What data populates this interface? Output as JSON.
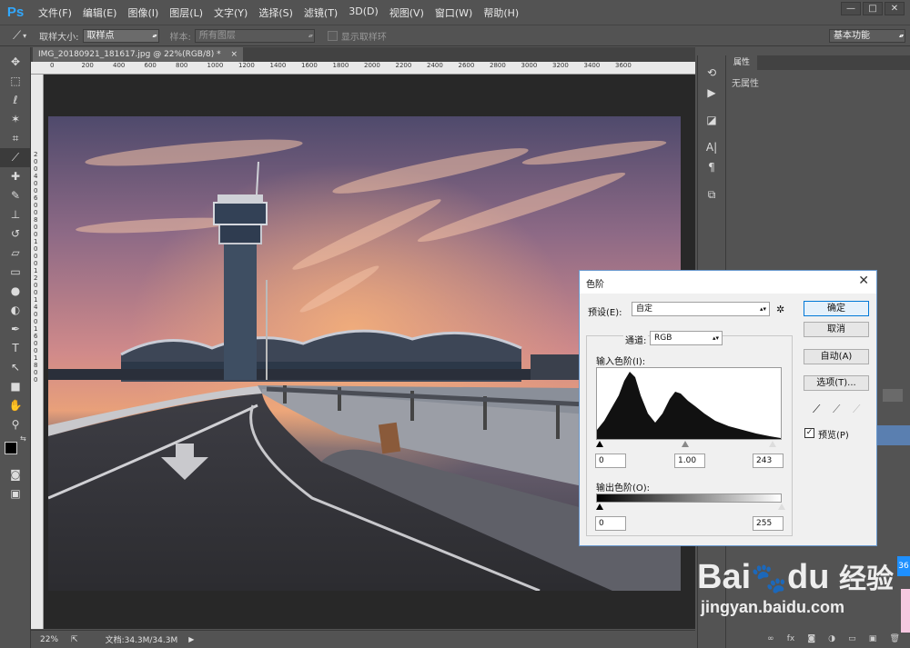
{
  "app": {
    "logo": "Ps"
  },
  "menu": [
    "文件(F)",
    "编辑(E)",
    "图像(I)",
    "图层(L)",
    "文字(Y)",
    "选择(S)",
    "滤镜(T)",
    "3D(D)",
    "视图(V)",
    "窗口(W)",
    "帮助(H)"
  ],
  "window_buttons": [
    "—",
    "□",
    "✕"
  ],
  "options": {
    "sample_size_label": "取样大小:",
    "sample_size_value": "取样点",
    "sample_label": "样本:",
    "sample_value": "所有图层",
    "show_ring": "显示取样环",
    "workspace": "基本功能"
  },
  "document": {
    "tab": "IMG_20180921_181617.jpg @ 22%(RGB/8) *",
    "close": "×"
  },
  "ruler": {
    "h_ticks": [
      "0",
      "200",
      "400",
      "600",
      "800",
      "1000",
      "1200",
      "1400",
      "1600",
      "1800",
      "2000",
      "2200",
      "2400",
      "2600",
      "2800",
      "3000",
      "3200",
      "3400",
      "3600"
    ],
    "v_ticks": [
      "2",
      "0",
      "0",
      "4",
      "0",
      "0",
      "6",
      "0",
      "0",
      "8",
      "0",
      "0",
      "1",
      "0",
      "0",
      "0",
      "1",
      "2",
      "0",
      "0",
      "1",
      "4",
      "0",
      "0",
      "1",
      "6",
      "0",
      "0",
      "1",
      "8",
      "0",
      "0"
    ]
  },
  "status": {
    "zoom": "22%",
    "doc": "文档:34.3M/34.3M"
  },
  "properties": {
    "tab": "属性",
    "body": "无属性"
  },
  "levels_dialog": {
    "title": "色阶",
    "preset_label": "预设(E):",
    "preset_value": "自定",
    "channel_label": "通道:",
    "channel_value": "RGB",
    "input_label": "输入色阶(I):",
    "input_black": "0",
    "input_gamma": "1.00",
    "input_white": "243",
    "output_label": "输出色阶(O):",
    "output_black": "0",
    "output_white": "255",
    "ok": "确定",
    "cancel": "取消",
    "auto": "自动(A)",
    "options": "选项(T)...",
    "preview": "预览(P)",
    "preview_checked": true
  },
  "watermark": {
    "brand_a": "Bai",
    "brand_b": "du",
    "cn": "经验",
    "url": "jingyan.baidu.com"
  },
  "edge_badge": "36"
}
